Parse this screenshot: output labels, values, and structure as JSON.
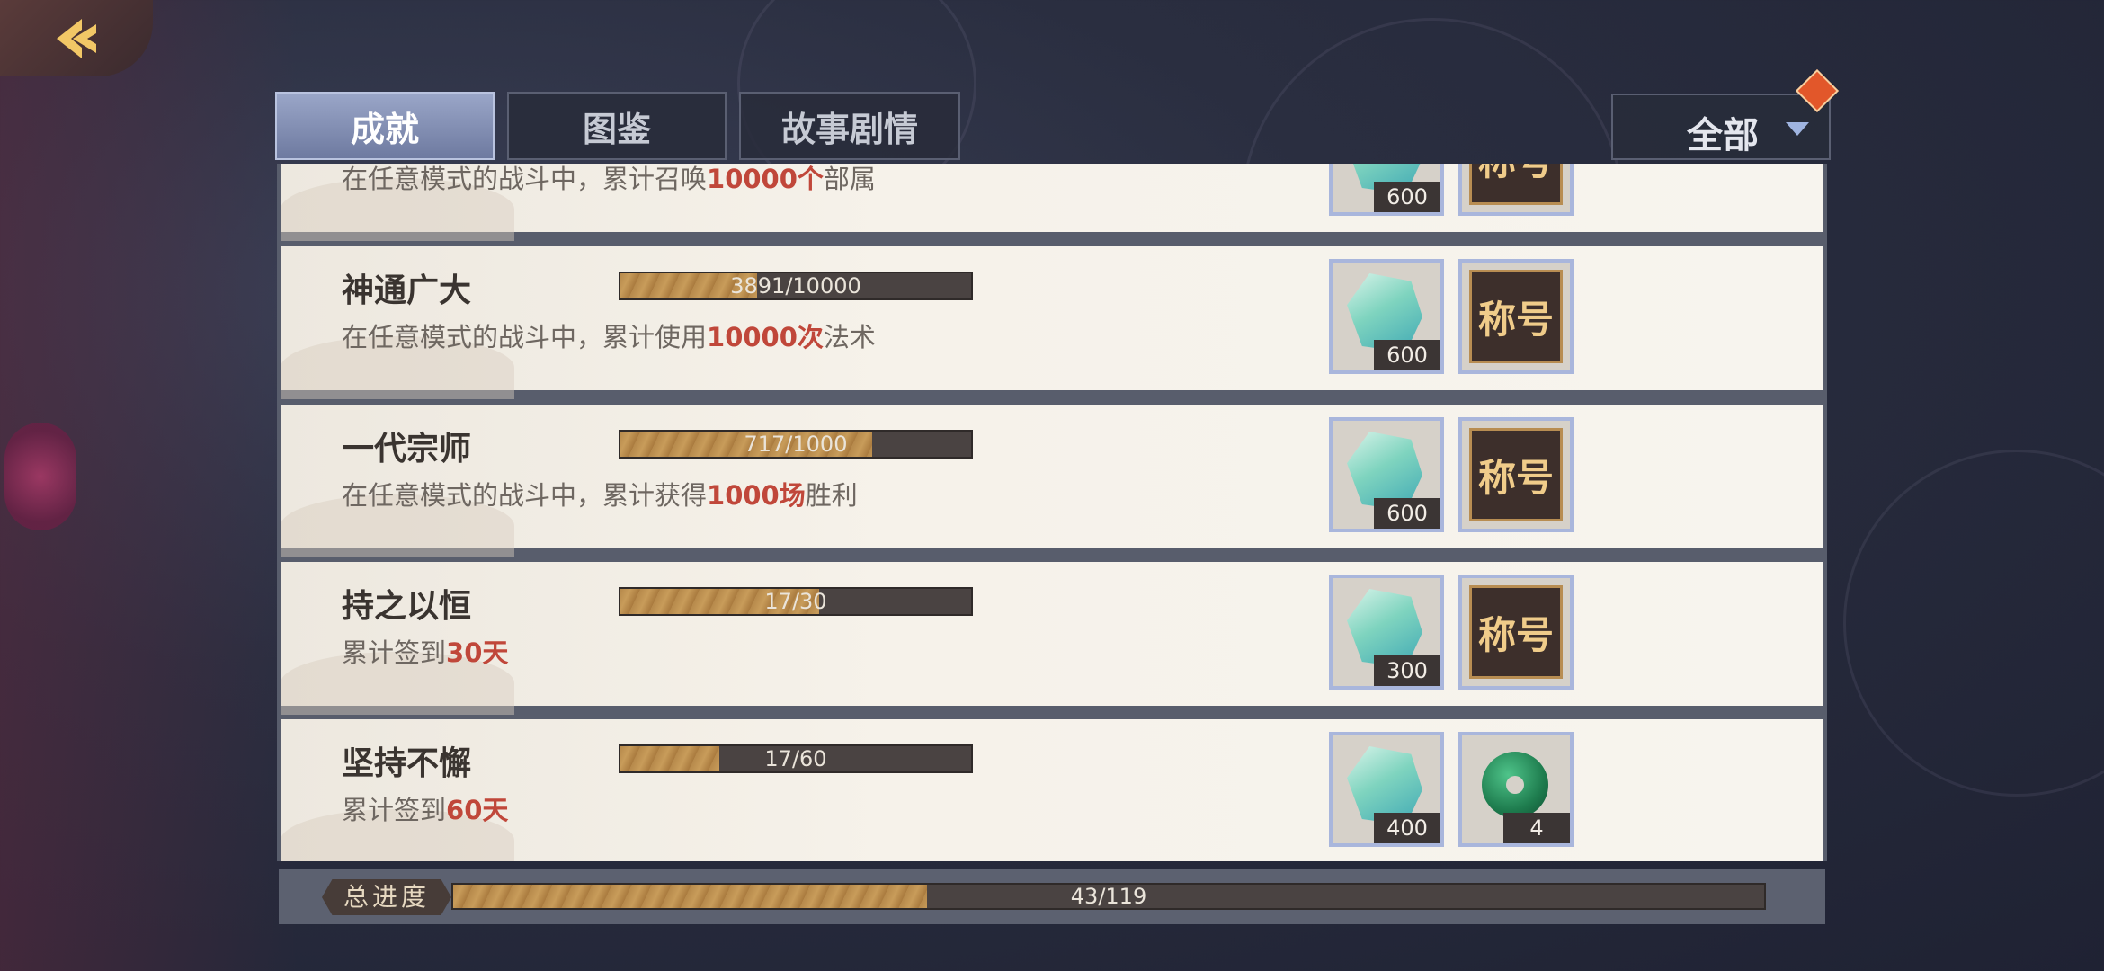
{
  "tabs": [
    {
      "label": "成就",
      "active": true
    },
    {
      "label": "图鉴",
      "active": false
    },
    {
      "label": "故事剧情",
      "active": false
    }
  ],
  "filter": {
    "selected": "全部"
  },
  "reward_title_label": "称号",
  "achievements": [
    {
      "title": "",
      "desc_before": "在任意模式的战斗中，累计召唤",
      "desc_highlight": "10000个",
      "desc_after": "部属",
      "progress_text": "",
      "progress_fraction": 0,
      "rewards": [
        {
          "type": "jade",
          "qty": "600"
        },
        {
          "type": "title"
        }
      ]
    },
    {
      "title": "神通广大",
      "desc_before": "在任意模式的战斗中，累计使用",
      "desc_highlight": "10000次",
      "desc_after": "法术",
      "progress_text": "3891/10000",
      "progress_fraction": 0.3891,
      "rewards": [
        {
          "type": "jade",
          "qty": "600"
        },
        {
          "type": "title"
        }
      ]
    },
    {
      "title": "一代宗师",
      "desc_before": "在任意模式的战斗中，累计获得",
      "desc_highlight": "1000场",
      "desc_after": "胜利",
      "progress_text": "717/1000",
      "progress_fraction": 0.717,
      "rewards": [
        {
          "type": "jade",
          "qty": "600"
        },
        {
          "type": "title"
        }
      ]
    },
    {
      "title": "持之以恒",
      "desc_before": "累计签到",
      "desc_highlight": "30天",
      "desc_after": "",
      "progress_text": "17/30",
      "progress_fraction": 0.5667,
      "rewards": [
        {
          "type": "jade",
          "qty": "300"
        },
        {
          "type": "title"
        }
      ]
    },
    {
      "title": "坚持不懈",
      "desc_before": "累计签到",
      "desc_highlight": "60天",
      "desc_after": "",
      "progress_text": "17/60",
      "progress_fraction": 0.2833,
      "rewards": [
        {
          "type": "jade",
          "qty": "400"
        },
        {
          "type": "pendant",
          "qty": "4"
        }
      ]
    }
  ],
  "total": {
    "label": "总进度",
    "progress_text": "43/119",
    "progress_fraction": 0.3613
  }
}
